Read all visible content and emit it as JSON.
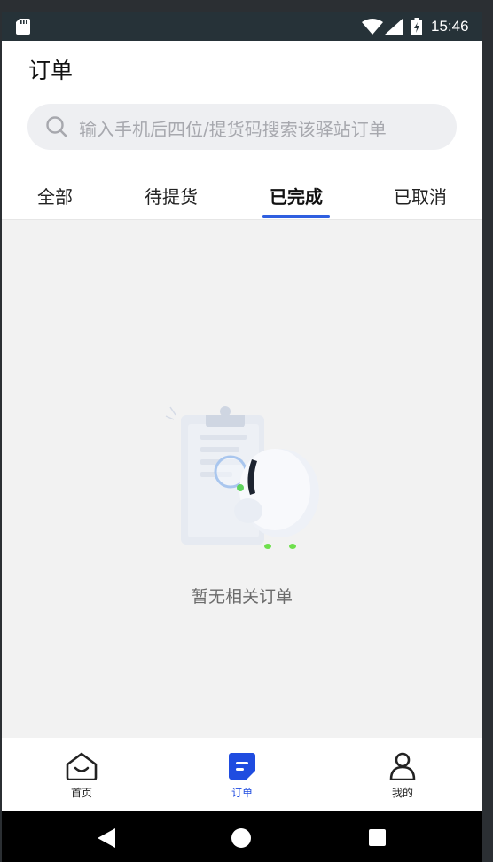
{
  "status_bar": {
    "time": "15:46"
  },
  "header": {
    "title": "订单",
    "search_placeholder": "输入手机后四位/提货码搜索该驿站订单"
  },
  "tabs": [
    {
      "label": "全部",
      "active": false
    },
    {
      "label": "待提货",
      "active": false
    },
    {
      "label": "已完成",
      "active": true
    },
    {
      "label": "已取消",
      "active": false
    }
  ],
  "empty_state": {
    "message": "暂无相关订单"
  },
  "bottom_nav": [
    {
      "label": "首页",
      "icon": "home-icon",
      "active": false
    },
    {
      "label": "订单",
      "icon": "orders-icon",
      "active": true
    },
    {
      "label": "我的",
      "icon": "profile-icon",
      "active": false
    }
  ],
  "colors": {
    "accent": "#2f5fe0",
    "status_bar": "#263238",
    "background": "#f2f2f2"
  }
}
